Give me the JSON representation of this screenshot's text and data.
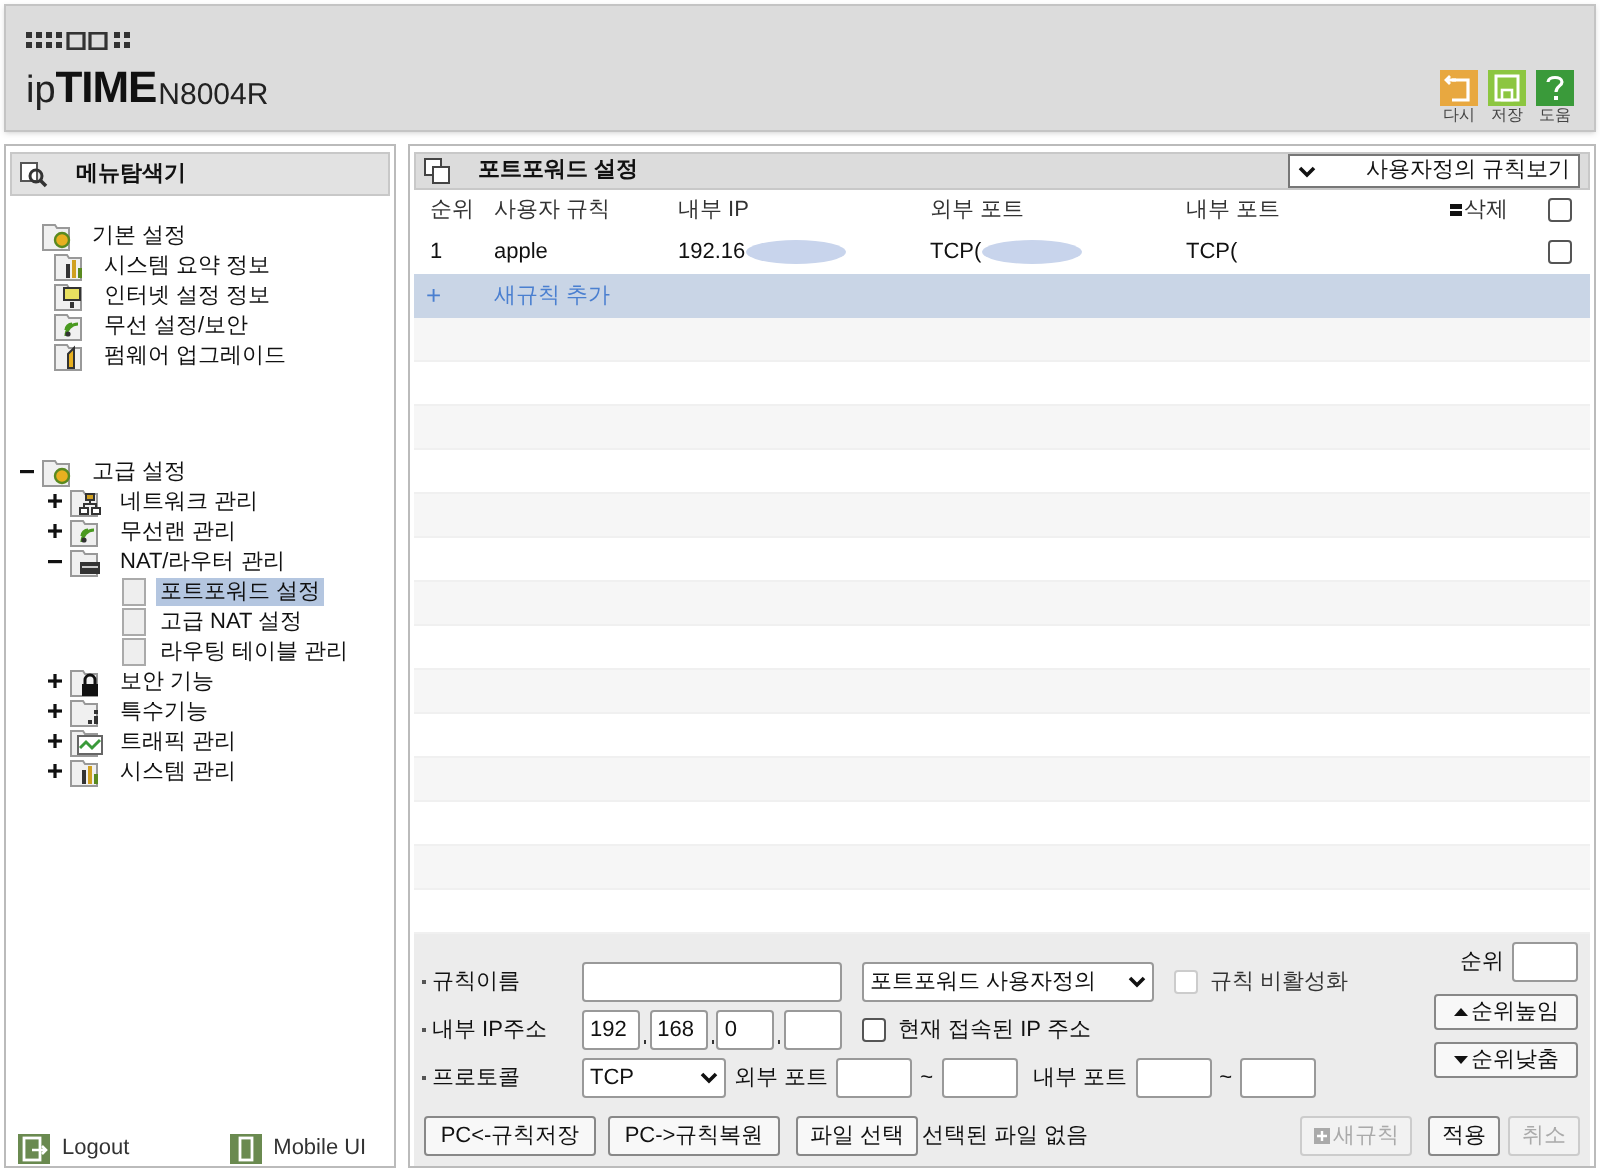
{
  "header": {
    "logo_prefix": "ip",
    "logo_brand": "TIME",
    "model": "N8004R"
  },
  "toolbar": [
    {
      "label": "다시",
      "kind": "undo"
    },
    {
      "label": "저장",
      "kind": "save"
    },
    {
      "label": "도움",
      "kind": "help"
    }
  ],
  "sidebar": {
    "title": "메뉴탐색기",
    "tree": [
      {
        "label": "기본 설정",
        "kind": "gear",
        "children": [
          {
            "label": "시스템 요약 정보",
            "kind": "chart",
            "selected": false
          },
          {
            "label": "인터넷 설정 정보",
            "kind": "monitor",
            "selected": false
          },
          {
            "label": "무선 설정/보안",
            "kind": "wifi",
            "selected": false
          },
          {
            "label": "펌웨어 업그레이드",
            "kind": "upload",
            "selected": false
          }
        ]
      },
      {
        "label": "고급 설정",
        "kind": "gear",
        "expanded": true,
        "children": [
          {
            "label": "네트워크 관리",
            "kind": "network",
            "expanded": false
          },
          {
            "label": "무선랜 관리",
            "kind": "wifi",
            "expanded": false
          },
          {
            "label": "NAT/라우터 관리",
            "kind": "router",
            "expanded": true,
            "children": [
              {
                "label": "포트포워드 설정",
                "kind": "page",
                "selected": true
              },
              {
                "label": "고급 NAT 설정",
                "kind": "page",
                "selected": false
              },
              {
                "label": "라우팅 테이블 관리",
                "kind": "page",
                "selected": false
              }
            ]
          },
          {
            "label": "보안 기능",
            "kind": "lock",
            "expanded": false
          },
          {
            "label": "특수기능",
            "kind": "special",
            "expanded": false
          },
          {
            "label": "트래픽 관리",
            "kind": "traffic",
            "expanded": false
          },
          {
            "label": "시스템 관리",
            "kind": "chart",
            "expanded": false
          }
        ]
      }
    ],
    "footer": [
      {
        "label": "Logout",
        "kind": "logout"
      },
      {
        "label": "Mobile UI",
        "kind": "mobile"
      }
    ]
  },
  "main": {
    "title": "포트포워드 설정",
    "view_select": "사용자정의 규칙보기",
    "columns": [
      "순위",
      "사용자 규칙",
      "내부 IP",
      "외부 포트",
      "내부 포트",
      "삭제"
    ],
    "delete_all_checked": false,
    "rows": [
      {
        "cells": [
          "1",
          "apple",
          "192.16",
          "TCP(",
          "TCP("
        ],
        "checked": false
      }
    ],
    "add_row": {
      "icon": "+",
      "label": "새규칙 추가"
    },
    "form": {
      "rule_name_label": "규칙이름",
      "rule_type": "포트포워드 사용자정의",
      "disable": {
        "label": "규칙 비활성화",
        "checked": false,
        "disabled": true
      },
      "ip_label": "내부 IP주소",
      "ip_octets": [
        "192",
        "168",
        "0"
      ],
      "current_ip": {
        "label": "현재 접속된 IP 주소",
        "checked": false
      },
      "protocol_label": "프로토콜",
      "protocol": "TCP",
      "ext_port": {
        "label": "외부 포트",
        "separator": "~"
      },
      "int_port": {
        "label": "내부 포트",
        "separator": "~"
      },
      "order_label": "순위",
      "order_up": "순위높임",
      "order_down": "순위낮춤"
    },
    "buttons": [
      {
        "label": "PC<-규칙저장"
      },
      {
        "label": "PC->규칙복원"
      },
      {
        "label": "파일 선택"
      }
    ],
    "file_status": "선택된 파일 없음",
    "actions": [
      {
        "label": "새규칙",
        "kind": "new",
        "disabled": true
      },
      {
        "label": "적용",
        "kind": "plain",
        "disabled": false
      },
      {
        "label": "취소",
        "kind": "plain",
        "disabled": true
      }
    ]
  }
}
